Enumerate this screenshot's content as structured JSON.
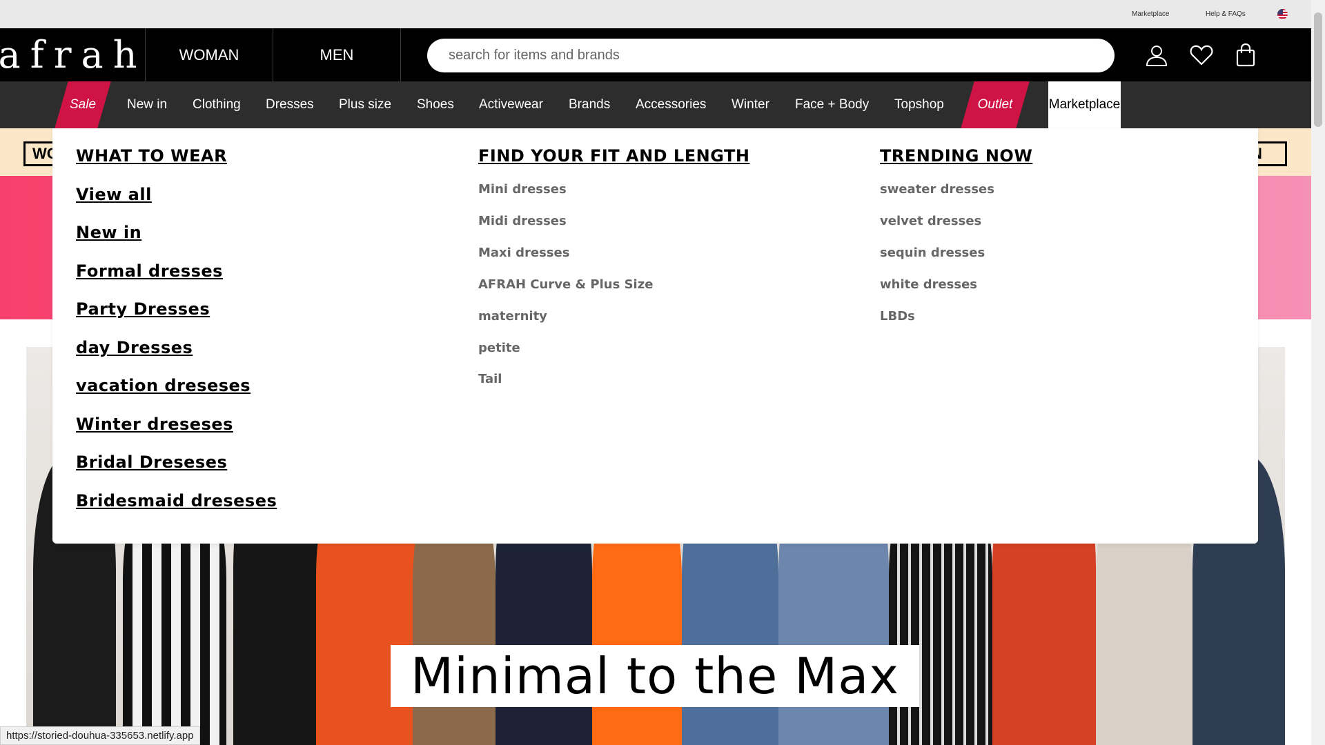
{
  "utility": {
    "marketplace": "Marketplace",
    "help": "Help & FAQs",
    "flag_icon": "us-flag-icon"
  },
  "header": {
    "logo": "afrah",
    "woman": "WOMAN",
    "men": "MEN",
    "search_placeholder": "search for items and brands",
    "icons": [
      "user-icon",
      "heart-icon",
      "bag-icon"
    ]
  },
  "nav": {
    "items": [
      "Sale",
      "New in",
      "Clothing",
      "Dresses",
      "Plus size",
      "Shoes",
      "Activewear",
      "Brands",
      "Accessories",
      "Winter",
      "Face + Body",
      "Topshop",
      "Outlet",
      "Marketplace"
    ],
    "accent": "#d01345"
  },
  "dropdown": {
    "what_to_wear": {
      "title": "WHAT TO WEAR",
      "links": [
        "View all",
        "New in",
        "Formal dresses",
        "Party Dresses",
        "day Dresses",
        "vacation dreseses",
        "Winter dreseses",
        "Bridal Dreseses",
        "Bridesmaid dreseses"
      ]
    },
    "fit": {
      "title": "FIND YOUR FIT AND LENGTH",
      "links": [
        "Mini dresses",
        "Midi dresses",
        "Maxi dresses",
        "AFRAH Curve & Plus Size",
        "maternity",
        "petite",
        "Tail"
      ]
    },
    "trending": {
      "title": "TRENDING NOW",
      "links": [
        "sweater dresses",
        "velvet dresses",
        "sequin dresses",
        "white dresses",
        "LBDs"
      ]
    }
  },
  "promo": {
    "left_text": "WO",
    "right_text": "N"
  },
  "hero": {
    "title": "Minimal to the Max"
  },
  "status_url": "https://storied-douhua-335653.netlify.app"
}
